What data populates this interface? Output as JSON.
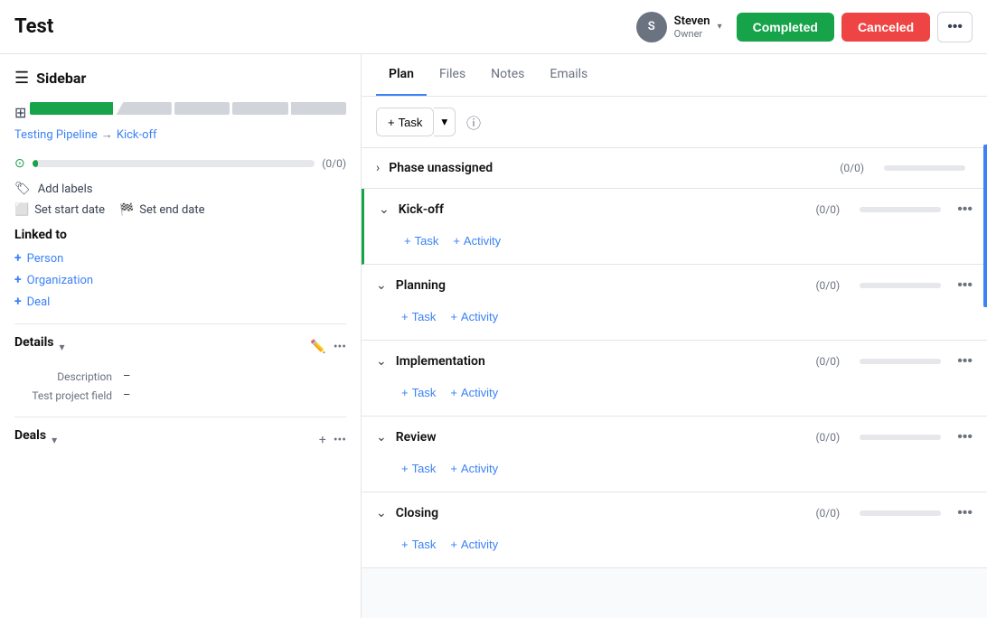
{
  "header": {
    "title": "Test",
    "user": {
      "name": "Steven",
      "role": "Owner",
      "avatar_initials": "S"
    },
    "btn_completed": "Completed",
    "btn_canceled": "Canceled",
    "btn_more": "···"
  },
  "sidebar": {
    "label": "Sidebar",
    "pipeline": {
      "breadcrumb_link": "Testing Pipeline",
      "separator": "→",
      "current": "Kick-off"
    },
    "progress": {
      "label": "(0/0)"
    },
    "add_labels": "Add labels",
    "set_start_date": "Set start date",
    "set_end_date": "Set end date",
    "linked_to": {
      "title": "Linked to",
      "items": [
        {
          "label": "Person"
        },
        {
          "label": "Organization"
        },
        {
          "label": "Deal"
        }
      ]
    },
    "details": {
      "title": "Details",
      "description_key": "Description",
      "description_val": "–",
      "field_key": "Test project field",
      "field_val": "–"
    },
    "deals": {
      "title": "Deals"
    }
  },
  "tabs": {
    "items": [
      {
        "label": "Plan",
        "active": true
      },
      {
        "label": "Files",
        "active": false
      },
      {
        "label": "Notes",
        "active": false
      },
      {
        "label": "Emails",
        "active": false
      }
    ]
  },
  "toolbar": {
    "task_label": "Task",
    "add_label": "+",
    "info_icon": "ℹ"
  },
  "phases": [
    {
      "id": "phase-unassigned",
      "name": "Phase unassigned",
      "count": "(0/0)",
      "progress": 0,
      "has_body": false,
      "is_kickoff": false
    },
    {
      "id": "kick-off",
      "name": "Kick-off",
      "count": "(0/0)",
      "progress": 0,
      "has_body": true,
      "is_kickoff": true,
      "task_label": "Task",
      "activity_label": "Activity"
    },
    {
      "id": "planning",
      "name": "Planning",
      "count": "(0/0)",
      "progress": 0,
      "has_body": true,
      "is_kickoff": false,
      "task_label": "Task",
      "activity_label": "Activity"
    },
    {
      "id": "implementation",
      "name": "Implementation",
      "count": "(0/0)",
      "progress": 0,
      "has_body": true,
      "is_kickoff": false,
      "task_label": "Task",
      "activity_label": "Activity"
    },
    {
      "id": "review",
      "name": "Review",
      "count": "(0/0)",
      "progress": 0,
      "has_body": true,
      "is_kickoff": false,
      "task_label": "Task",
      "activity_label": "Activity"
    },
    {
      "id": "closing",
      "name": "Closing",
      "count": "(0/0)",
      "progress": 0,
      "has_body": true,
      "is_kickoff": false,
      "task_label": "Task",
      "activity_label": "Activity"
    }
  ],
  "colors": {
    "green": "#16a34a",
    "red": "#ef4444",
    "blue": "#3b82f6"
  }
}
